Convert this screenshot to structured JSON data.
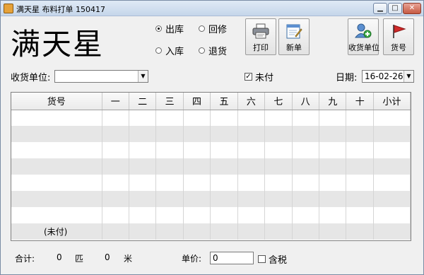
{
  "window": {
    "title": "满天星 布料打单 150417",
    "minimize": "▁",
    "maximize": "□",
    "close": "✕"
  },
  "logo": "满天星",
  "radios": [
    {
      "label": "出库",
      "checked": true
    },
    {
      "label": "回修",
      "checked": false
    },
    {
      "label": "入库",
      "checked": false
    },
    {
      "label": "退货",
      "checked": false
    }
  ],
  "toolbar": {
    "print": {
      "label": "打印",
      "icon": "printer-icon"
    },
    "new": {
      "label": "新单",
      "icon": "notepad-icon"
    },
    "receiver": {
      "label": "收货单位",
      "icon": "add-user-icon"
    },
    "code": {
      "label": "货号",
      "icon": "flag-icon"
    }
  },
  "receiver_field": {
    "label": "收货单位:",
    "value": ""
  },
  "unpaid_check": {
    "label": "未付",
    "checked": true,
    "mark": "✓"
  },
  "date_field": {
    "label": "日期:",
    "value": "16-02-26"
  },
  "table": {
    "headers": [
      "货号",
      "一",
      "二",
      "三",
      "四",
      "五",
      "六",
      "七",
      "八",
      "九",
      "十",
      "小计"
    ],
    "footer_note": "(未付)"
  },
  "footer": {
    "total_label": "合计:",
    "total_count": "0",
    "pieces_unit": "匹",
    "meters_value": "0",
    "meters_unit": "米",
    "price_label": "单价:",
    "price_value": "0",
    "tax_label": "含税"
  },
  "colors": {
    "title_bar": "#c5d6ea",
    "row_alt": "#e6e6e6",
    "flag": "#d12a2a"
  }
}
